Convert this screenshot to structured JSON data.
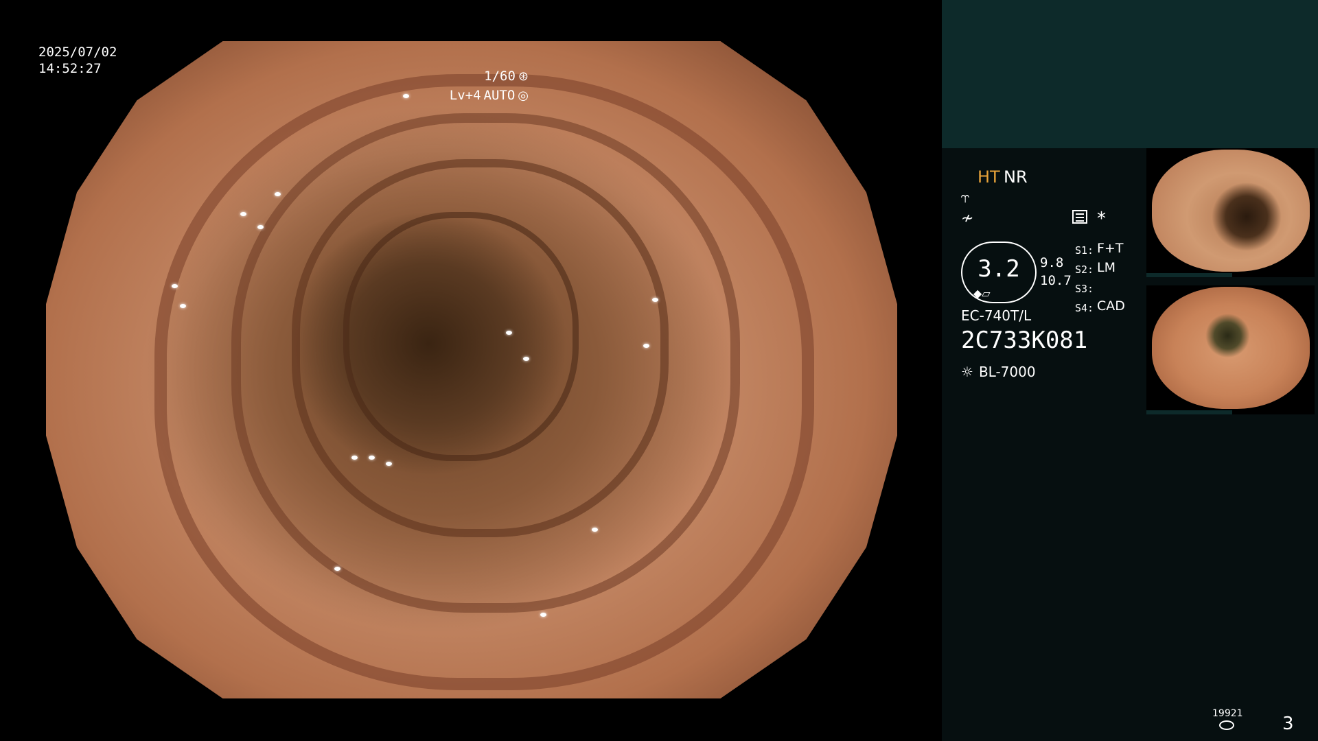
{
  "overlay": {
    "date": "2025/07/02",
    "time": "14:52:27",
    "shutter": "1/60",
    "level": "Lv+4",
    "exposure_mode": "AUTO"
  },
  "panel": {
    "mode_ht": "HT",
    "mode_nr": "NR",
    "zoom": "3.2",
    "zoom_sub1": "9.8",
    "zoom_sub2": "10.7",
    "slots": [
      {
        "key": "S1:",
        "value": "F+T"
      },
      {
        "key": "S2:",
        "value": "LM"
      },
      {
        "key": "S3:",
        "value": ""
      },
      {
        "key": "S4:",
        "value": "CAD"
      }
    ],
    "scope_model": "EC-740T/L",
    "scope_serial": "2C733K081",
    "light_source": "BL-7000",
    "image_count": "19921",
    "page_number": "3"
  },
  "icons": {
    "shutter": "aperture-icon",
    "exposure": "iris-icon",
    "light": "sun-icon",
    "storage": "database-icon"
  }
}
